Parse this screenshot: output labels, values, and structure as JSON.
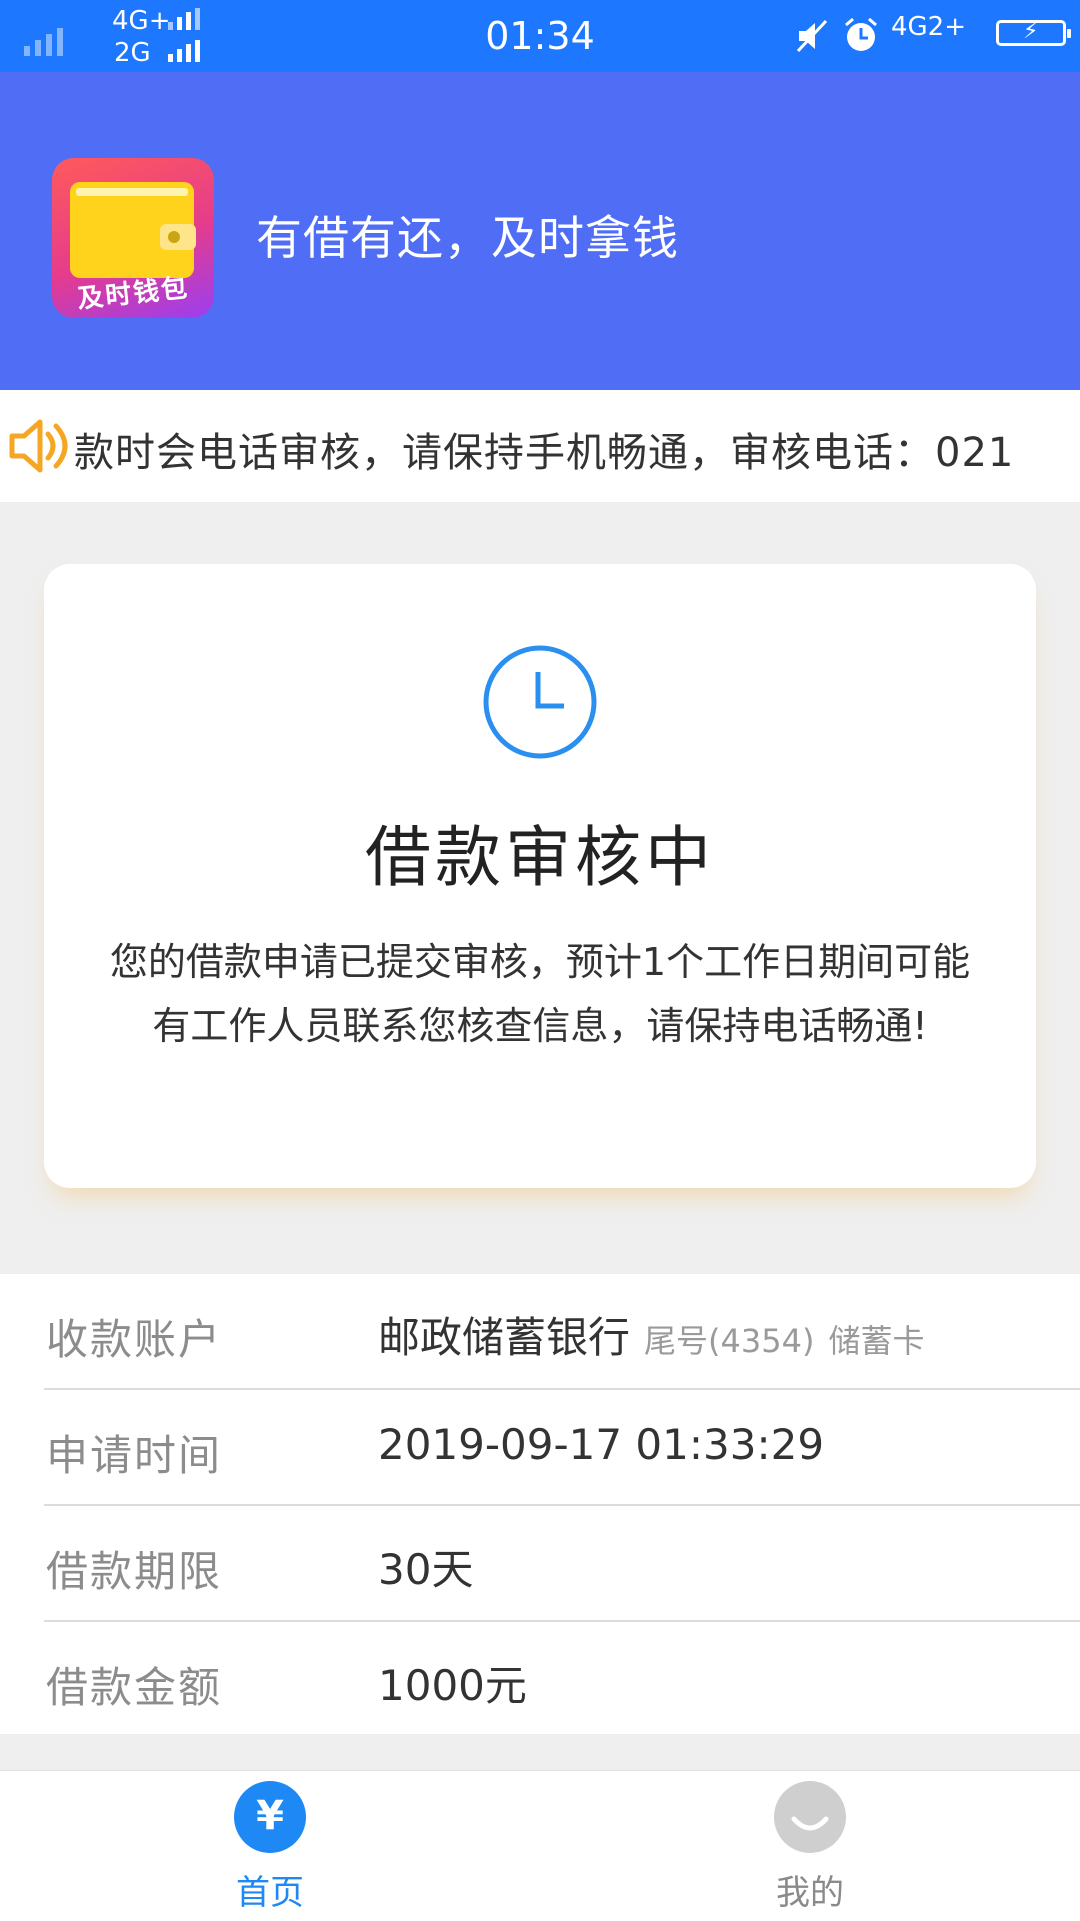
{
  "status_bar": {
    "network_top": "4G+",
    "network_bottom": "2G",
    "time": "01:34",
    "network_right": "4G2+",
    "icons": [
      "signal-icon",
      "mute-icon",
      "alarm-icon",
      "battery-charging-icon"
    ]
  },
  "header": {
    "logo_text": "及时钱包",
    "slogan": "有借有还，及时拿钱",
    "background_color": "#4f6df5"
  },
  "notice": {
    "icon": "speaker-icon",
    "text": "款时会电话审核，请保持手机畅通，审核电话：021"
  },
  "status_card": {
    "icon": "clock-icon",
    "title": "借款审核中",
    "description": "您的借款申请已提交审核，预计1个工作日期间可能有工作人员联系您核查信息，请保持电话畅通!"
  },
  "info_rows": [
    {
      "label": "收款账户",
      "value": "邮政储蓄银行",
      "sub": "尾号(4354)",
      "sub2": "储蓄卡"
    },
    {
      "label": "申请时间",
      "value": "2019-09-17 01:33:29"
    },
    {
      "label": "借款期限",
      "value": "30天"
    },
    {
      "label": "借款金额",
      "value": "1000元"
    }
  ],
  "tabbar": {
    "home_label": "首页",
    "home_icon_text": "¥",
    "mine_label": "我的",
    "active_color": "#1e88f5",
    "inactive_color": "#8a8a8a"
  }
}
